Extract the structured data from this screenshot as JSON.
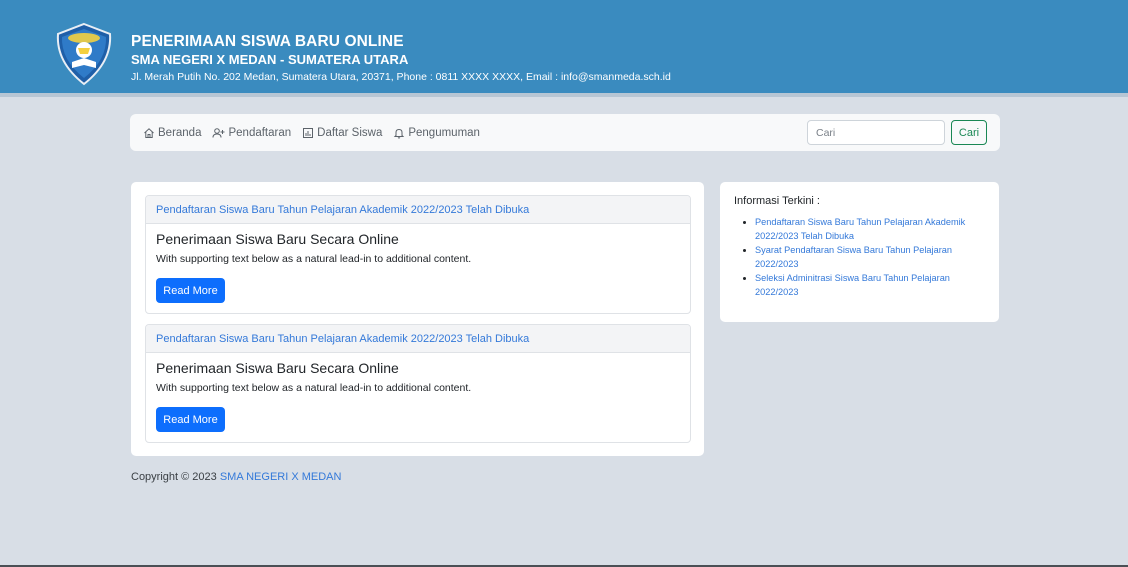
{
  "header": {
    "title": "PENERIMAAN SISWA BARU ONLINE",
    "school": "SMA NEGERI X MEDAN - SUMATERA UTARA",
    "address": "Jl. Merah Putih No. 202 Medan, Sumatera Utara, 20371, Phone : 0811 XXXX XXXX, Email : info@smanmeda.sch.id"
  },
  "nav": {
    "items": [
      {
        "label": "Beranda",
        "icon": "home-icon"
      },
      {
        "label": "Pendaftaran",
        "icon": "person-add-icon"
      },
      {
        "label": "Daftar Siswa",
        "icon": "chart-icon"
      },
      {
        "label": "Pengumuman",
        "icon": "bell-icon"
      }
    ],
    "search_placeholder": "Cari",
    "search_button": "Cari"
  },
  "cards": [
    {
      "header": "Pendaftaran Siswa Baru Tahun Pelajaran Akademik 2022/2023 Telah Dibuka",
      "title": "Penerimaan Siswa Baru Secara Online",
      "text": "With supporting text below as a natural lead-in to additional content.",
      "button": "Read More"
    },
    {
      "header": "Pendaftaran Siswa Baru Tahun Pelajaran Akademik 2022/2023 Telah Dibuka",
      "title": "Penerimaan Siswa Baru Secara Online",
      "text": "With supporting text below as a natural lead-in to additional content.",
      "button": "Read More"
    }
  ],
  "sidebar": {
    "title": "Informasi Terkini :",
    "items": [
      "Pendaftaran Siswa Baru Tahun Pelajaran Akademik 2022/2023 Telah Dibuka",
      "Syarat Pendaftaran Siswa Baru Tahun Pelajaran 2022/2023",
      "Seleksi Adminitrasi Siswa Baru Tahun Pelajaran 2022/2023"
    ]
  },
  "footer": {
    "copyright": "Copyright © 2023",
    "link": "SMA NEGERI X MEDAN"
  },
  "colors": {
    "header_bg": "#3a8bbf",
    "page_bg": "#d8dee6",
    "link": "#3479d9",
    "primary_button": "#0d6efd",
    "search_button": "#198754"
  }
}
